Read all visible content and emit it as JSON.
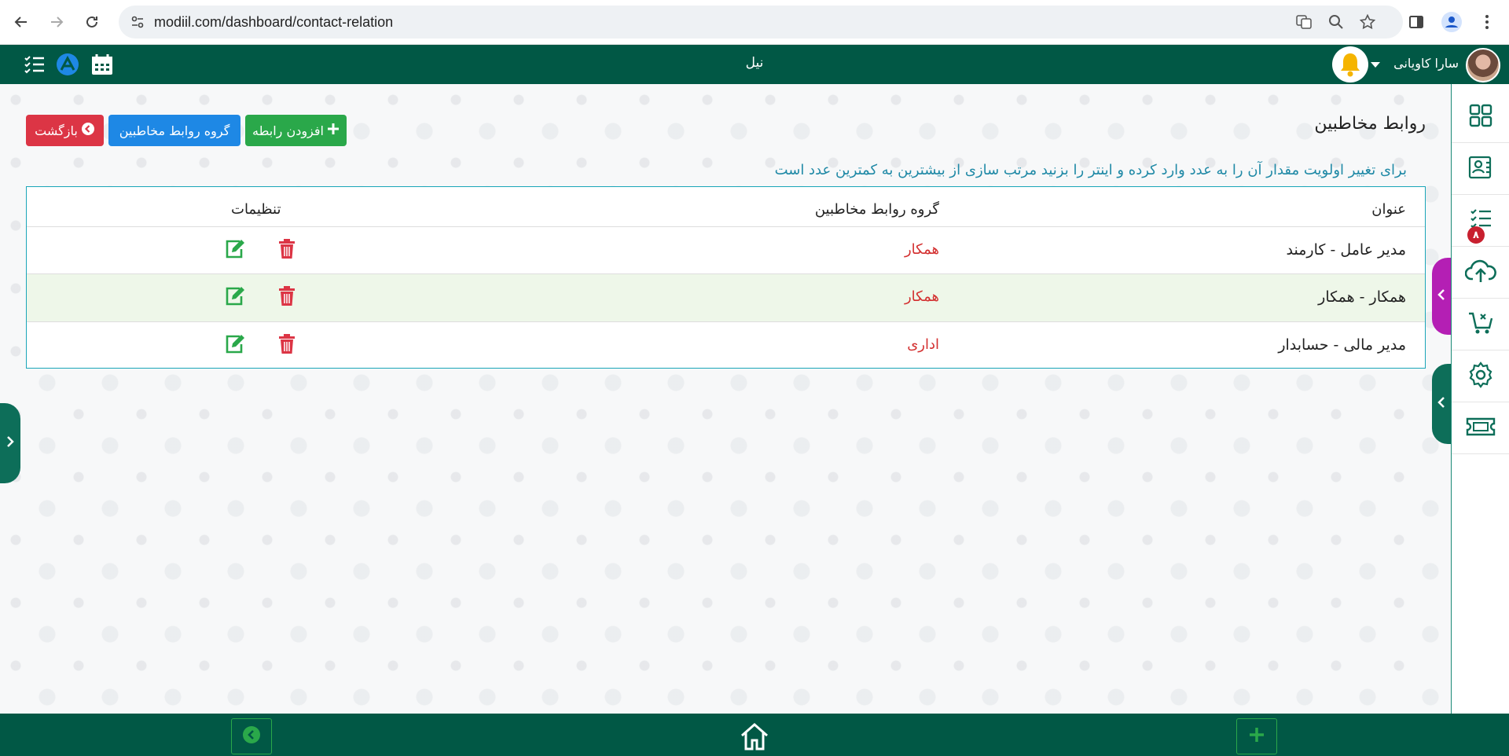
{
  "browser": {
    "url": "modiil.com/dashboard/contact-relation"
  },
  "header": {
    "app_title": "نیل",
    "user_name": "سارا کاویانی"
  },
  "page": {
    "heading": "روابط مخاطبین",
    "hint": "برای تغییر اولویت مقدار آن را به عدد وارد کرده و اینتر را بزنید مرتب سازی از بیشترین به کمترین عدد است",
    "buttons": {
      "add_relation": "افزودن رابطه",
      "relation_groups": "گروه روابط مخاطبین",
      "back": "بازگشت"
    }
  },
  "table": {
    "headers": {
      "title": "عنوان",
      "group": "گروه روابط مخاطبین",
      "settings": "تنظیمات"
    },
    "rows": [
      {
        "title": "مدیر عامل - کارمند",
        "group": "همکار"
      },
      {
        "title": "همکار - همکار",
        "group": "همکار"
      },
      {
        "title": "مدیر مالی - حسابدار",
        "group": "اداری"
      }
    ]
  },
  "rail": {
    "tasks_badge": "۸"
  },
  "colors": {
    "header_green": "#015845",
    "accent_green": "#2aa84a",
    "blue": "#1e88e5",
    "red": "#dc3545",
    "purple": "#b41fb4"
  }
}
